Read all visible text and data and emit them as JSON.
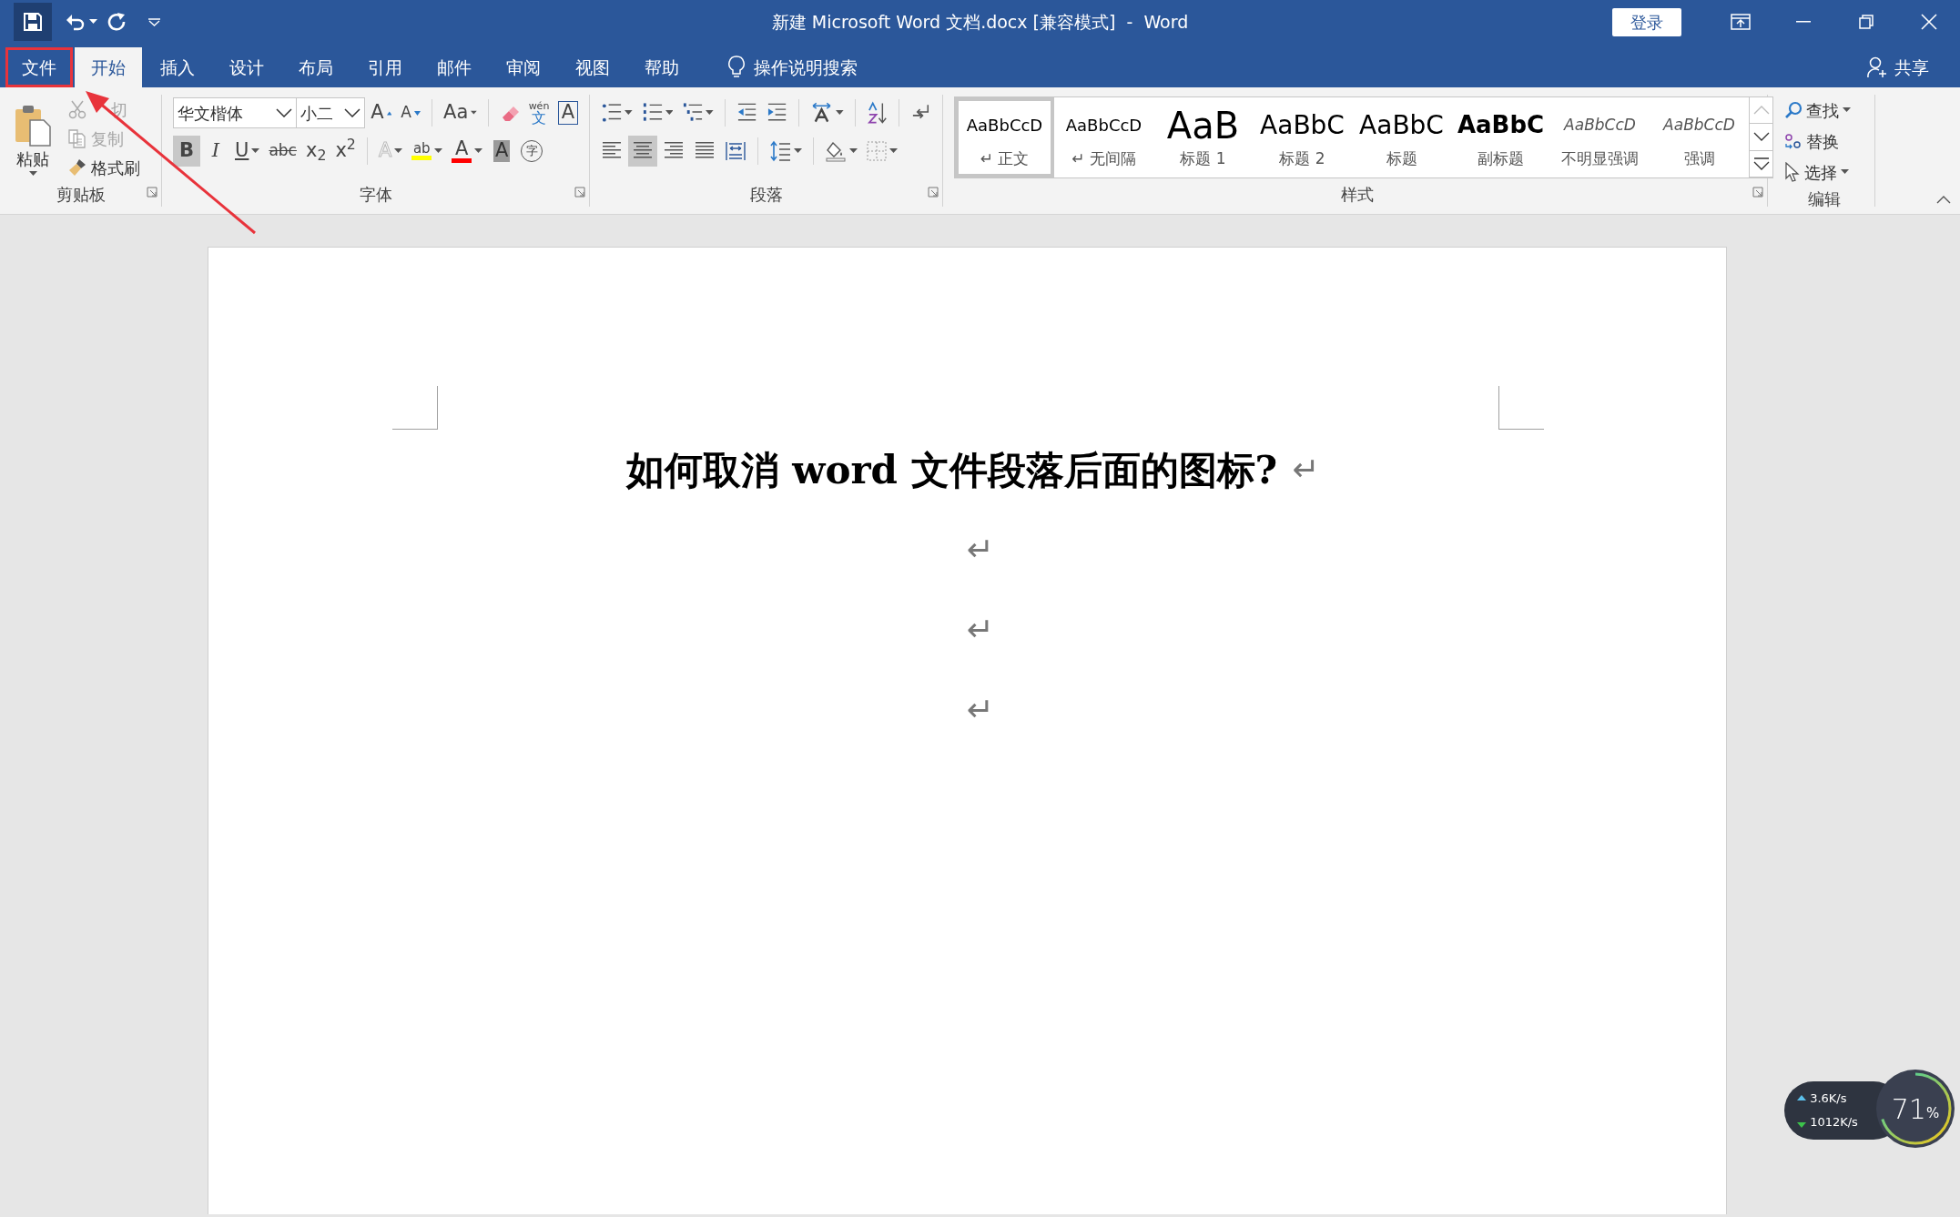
{
  "window": {
    "title": "新建 Microsoft Word 文档.docx [兼容模式]  -  Word",
    "sign_in": "登录"
  },
  "tabs": [
    {
      "label": "文件",
      "selected": false,
      "outlined": true
    },
    {
      "label": "开始",
      "selected": true,
      "outlined": false
    },
    {
      "label": "插入",
      "selected": false,
      "outlined": false
    },
    {
      "label": "设计",
      "selected": false,
      "outlined": false
    },
    {
      "label": "布局",
      "selected": false,
      "outlined": false
    },
    {
      "label": "引用",
      "selected": false,
      "outlined": false
    },
    {
      "label": "邮件",
      "selected": false,
      "outlined": false
    },
    {
      "label": "审阅",
      "selected": false,
      "outlined": false
    },
    {
      "label": "视图",
      "selected": false,
      "outlined": false
    },
    {
      "label": "帮助",
      "selected": false,
      "outlined": false
    }
  ],
  "tell_me": "操作说明搜索",
  "share": "共享",
  "clipboard": {
    "title": "剪贴板",
    "paste": "粘贴",
    "items": [
      {
        "kind": "cut",
        "label": "切",
        "disabled": true
      },
      {
        "kind": "copy",
        "label": "复制",
        "disabled": true
      },
      {
        "kind": "painter",
        "label": "格式刷",
        "disabled": false
      }
    ]
  },
  "font": {
    "title": "字体",
    "font_name": "华文楷体",
    "font_size": "小二",
    "row1": [
      {
        "kind": "grow",
        "glyph": "A",
        "dropdown": false
      },
      {
        "kind": "shrink",
        "glyph": "A",
        "dropdown": false
      },
      {
        "kind": "case",
        "glyph": "Aa",
        "dropdown": true
      },
      {
        "kind": "clear",
        "dropdown": false
      },
      {
        "kind": "phonetic",
        "glyph": "文",
        "ruby": "wén",
        "dropdown": false
      },
      {
        "kind": "border",
        "glyph": "A",
        "dropdown": false
      }
    ],
    "row2": [
      {
        "kind": "bold",
        "glyph": "B",
        "selected": true,
        "dropdown": false
      },
      {
        "kind": "italic",
        "glyph": "I",
        "selected": false,
        "dropdown": false
      },
      {
        "kind": "underline",
        "glyph": "U",
        "selected": false,
        "dropdown": true
      },
      {
        "kind": "strike",
        "glyph": "abc",
        "selected": false,
        "dropdown": false
      },
      {
        "kind": "script",
        "glyph": "x$_{2}$",
        "selected": false,
        "dropdown": false
      },
      {
        "kind": "script",
        "glyph": "x$^{2}$",
        "selected": false,
        "dropdown": false
      },
      {
        "kind": "effects",
        "glyph": "A",
        "selected": false,
        "dropdown": true
      },
      {
        "kind": "highlight",
        "glyph": "ab",
        "selected": false,
        "dropdown": true,
        "color": "#ffff00"
      },
      {
        "kind": "fontcolor",
        "glyph": "A",
        "selected": false,
        "dropdown": true,
        "color": "#ff0000"
      },
      {
        "kind": "shading",
        "glyph": "A",
        "selected": false,
        "dropdown": false
      },
      {
        "kind": "enclose",
        "glyph": "字",
        "selected": false,
        "dropdown": false
      }
    ]
  },
  "paragraph": {
    "title": "段落",
    "alignment": [
      {
        "selected": false
      },
      {
        "selected": true
      },
      {
        "selected": false
      },
      {
        "selected": false
      },
      {
        "selected": false
      }
    ]
  },
  "styles": {
    "title": "样式",
    "items": [
      {
        "kind": "normal",
        "preview": "AaBbCcD",
        "label": "↵ 正文",
        "selected": true
      },
      {
        "kind": "normal",
        "preview": "AaBbCcD",
        "label": "↵ 无间隔",
        "selected": false
      },
      {
        "kind": "h1",
        "preview": "AaB",
        "label": "标题 1",
        "selected": false
      },
      {
        "kind": "h2",
        "preview": "AaBbC",
        "label": "标题 2",
        "selected": false
      },
      {
        "kind": "title",
        "preview": "AaBbC",
        "label": "标题",
        "selected": false
      },
      {
        "kind": "subtitle",
        "preview": "AaBbC",
        "label": "副标题",
        "selected": false
      },
      {
        "kind": "emphasis",
        "preview": "AaBbCcD",
        "label": "不明显强调",
        "selected": false
      },
      {
        "kind": "emphasis",
        "preview": "AaBbCcD",
        "label": "强调",
        "selected": false
      }
    ]
  },
  "editing": {
    "title": "编辑",
    "items": [
      {
        "kind": "find",
        "label": "查找",
        "dropdown": true
      },
      {
        "kind": "replace",
        "label": "替换",
        "dropdown": false
      },
      {
        "kind": "select",
        "label": "选择",
        "dropdown": true
      }
    ]
  },
  "document": {
    "paragraphs": [
      {
        "kind": "title",
        "text": "如何取消 word 文件段落后面的图标?",
        "mark": "↵"
      },
      {
        "kind": "empty",
        "mark": "↵"
      },
      {
        "kind": "empty",
        "mark": "↵"
      },
      {
        "kind": "empty",
        "mark": "↵"
      }
    ]
  },
  "network_widget": {
    "upload": "3.6K/s",
    "download": "1012K/s",
    "percent": "71",
    "unit": "%"
  }
}
